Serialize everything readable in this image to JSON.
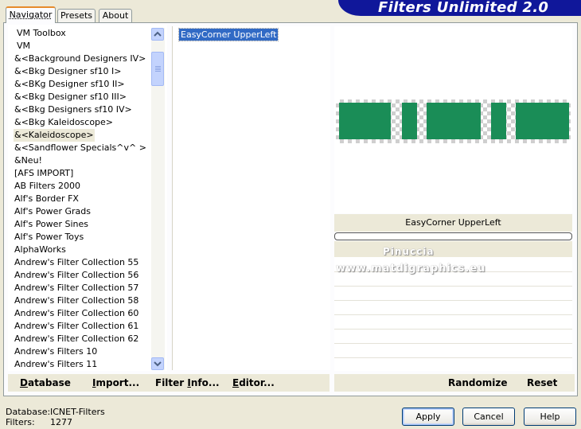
{
  "app": {
    "title": "Filters Unlimited 2.0"
  },
  "tabs": [
    {
      "label": "Navigator",
      "active": true
    },
    {
      "label": "Presets",
      "active": false
    },
    {
      "label": "About",
      "active": false
    }
  ],
  "categories": {
    "items": [
      "VM Toolbox",
      "VM",
      "&<Background Designers IV>",
      "&<Bkg Designer sf10 I>",
      "&<BKg Designer sf10 II>",
      "&<Bkg Designer sf10 III>",
      "&<Bkg Designers sf10 IV>",
      "&<Bkg Kaleidoscope>",
      "&<Kaleidoscope>",
      "&<Sandflower Specials^v^ >",
      "&Neu!",
      "[AFS IMPORT]",
      "AB Filters 2000",
      "Alf's Border FX",
      "Alf's Power Grads",
      "Alf's Power Sines",
      "Alf's Power Toys",
      "AlphaWorks",
      "Andrew's Filter Collection 55",
      "Andrew's Filter Collection 56",
      "Andrew's Filter Collection 57",
      "Andrew's Filter Collection 58",
      "Andrew's Filter Collection 60",
      "Andrew's Filter Collection 61",
      "Andrew's Filter Collection 62",
      "Andrew's Filters 10",
      "Andrew's Filters 11"
    ],
    "selected": "&<Kaleidoscope>"
  },
  "filters": {
    "items": [
      "EasyCorner UpperLeft"
    ],
    "selected": "EasyCorner UpperLeft"
  },
  "preview": {
    "filter_name": "EasyCorner UpperLeft",
    "bar_color": "#1a8d57",
    "progress": 0
  },
  "watermark": {
    "line1": "Pinuccia",
    "line2": "www.matdigraphics.eu"
  },
  "left_buttons": [
    {
      "label": "Database",
      "u": "D",
      "rest": "atabase"
    },
    {
      "label": "Import...",
      "u": "I",
      "rest": "mport..."
    },
    {
      "label": "Filter Info...",
      "pre": "Filter ",
      "u": "I",
      "rest": "nfo..."
    },
    {
      "label": "Editor...",
      "u": "E",
      "rest": "ditor..."
    }
  ],
  "right_buttons": {
    "randomize": "Randomize",
    "reset": "Reset"
  },
  "status": {
    "database_label": "Database:",
    "database_value": "ICNET-Filters",
    "filters_label": "Filters:",
    "filters_value": "1277"
  },
  "dialog_buttons": {
    "apply": "Apply",
    "cancel": "Cancel",
    "help": "Help"
  }
}
